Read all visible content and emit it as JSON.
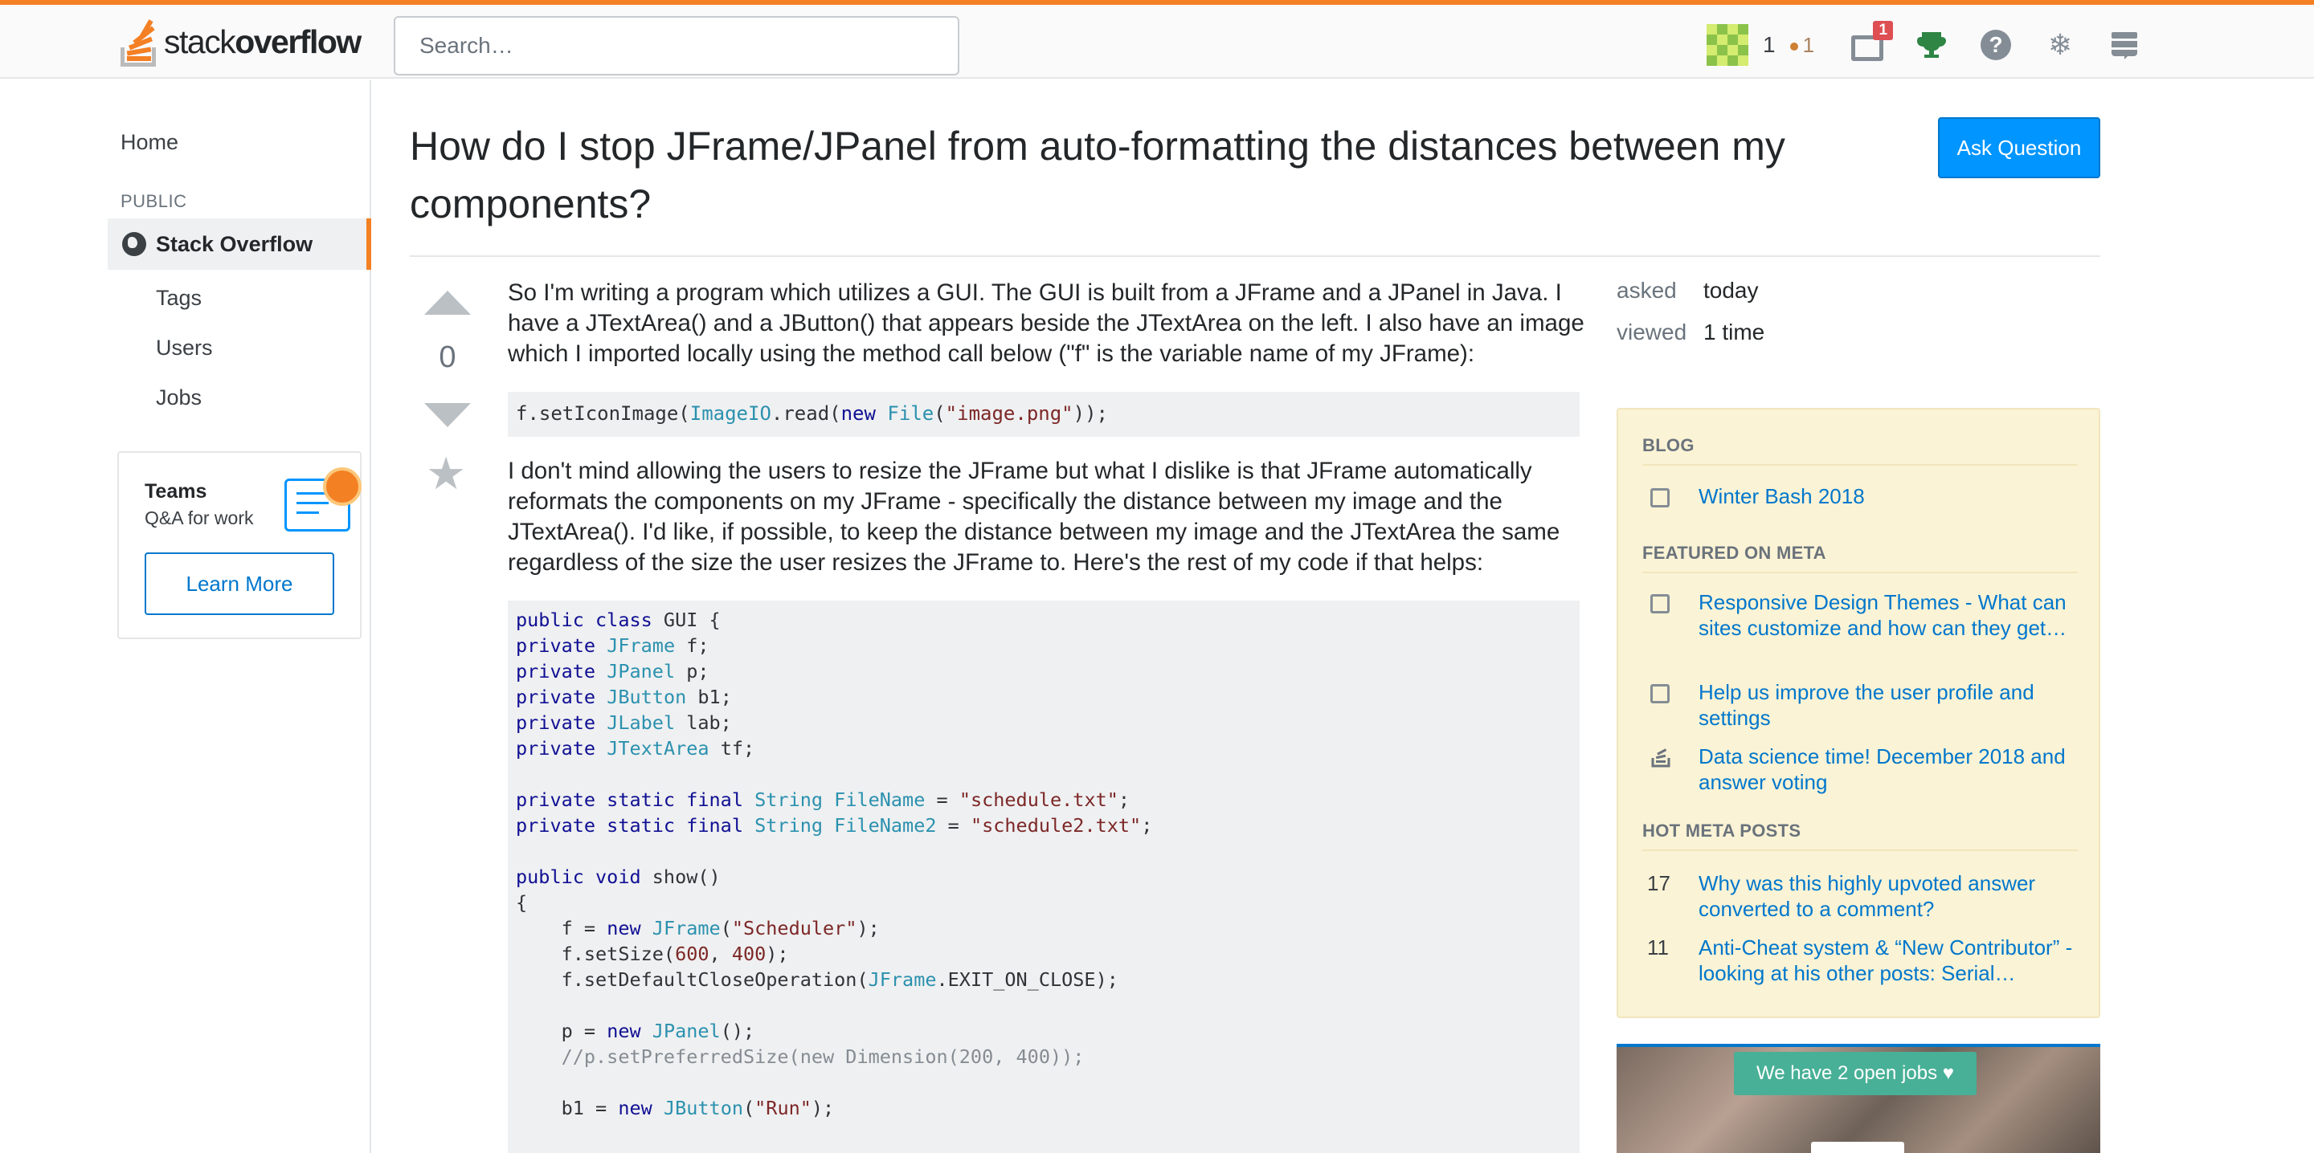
{
  "header": {
    "logo_light": "stack",
    "logo_bold": "overflow",
    "search_placeholder": "Search…",
    "reputation": "1",
    "bronze_badges": "1",
    "inbox_count": "1"
  },
  "nav": {
    "home": "Home",
    "public_heading": "PUBLIC",
    "stack_overflow": "Stack Overflow",
    "tags": "Tags",
    "users": "Users",
    "jobs": "Jobs"
  },
  "teams": {
    "title": "Teams",
    "subtitle": "Q&A for work",
    "button": "Learn More"
  },
  "question": {
    "title": "How do I stop JFrame/JPanel from auto-formatting the distances between my components?",
    "ask_button": "Ask Question",
    "votes": "0",
    "para1": "So I'm writing a program which utilizes a GUI. The GUI is built from a JFrame and a JPanel in Java. I have a JTextArea() and a JButton() that appears beside the JTextArea on the left. I also have an image which I imported locally using the method call below (\"f\" is the variable name of my JFrame):",
    "para2": "I don't mind allowing the users to resize the JFrame but what I dislike is that JFrame automatically reformats the components on my JFrame - specifically the distance between my image and the JTextArea(). I'd like, if possible, to keep the distance between my image and the JTextArea the same regardless of the size the user resizes the JFrame to. Here's the rest of my code if that helps:",
    "code_line": [
      {
        "t": "f.setIconImage(",
        "c": ""
      },
      {
        "t": "ImageIO",
        "c": "ty"
      },
      {
        "t": ".read(",
        "c": ""
      },
      {
        "t": "new",
        "c": "kw"
      },
      {
        "t": " ",
        "c": ""
      },
      {
        "t": "File",
        "c": "ty"
      },
      {
        "t": "(",
        "c": ""
      },
      {
        "t": "\"image.png\"",
        "c": "st"
      },
      {
        "t": "));",
        "c": ""
      }
    ],
    "code_block": [
      [
        {
          "t": "public class",
          "c": "kw"
        },
        {
          "t": " GUI {",
          "c": ""
        }
      ],
      [
        {
          "t": "private",
          "c": "kw"
        },
        {
          "t": " ",
          "c": ""
        },
        {
          "t": "JFrame",
          "c": "ty"
        },
        {
          "t": " f;",
          "c": ""
        }
      ],
      [
        {
          "t": "private",
          "c": "kw"
        },
        {
          "t": " ",
          "c": ""
        },
        {
          "t": "JPanel",
          "c": "ty"
        },
        {
          "t": " p;",
          "c": ""
        }
      ],
      [
        {
          "t": "private",
          "c": "kw"
        },
        {
          "t": " ",
          "c": ""
        },
        {
          "t": "JButton",
          "c": "ty"
        },
        {
          "t": " b1;",
          "c": ""
        }
      ],
      [
        {
          "t": "private",
          "c": "kw"
        },
        {
          "t": " ",
          "c": ""
        },
        {
          "t": "JLabel",
          "c": "ty"
        },
        {
          "t": " lab;",
          "c": ""
        }
      ],
      [
        {
          "t": "private",
          "c": "kw"
        },
        {
          "t": " ",
          "c": ""
        },
        {
          "t": "JTextArea",
          "c": "ty"
        },
        {
          "t": " tf;",
          "c": ""
        }
      ],
      [],
      [
        {
          "t": "private static final",
          "c": "kw"
        },
        {
          "t": " ",
          "c": ""
        },
        {
          "t": "String",
          "c": "ty"
        },
        {
          "t": " ",
          "c": ""
        },
        {
          "t": "FileName",
          "c": "ty"
        },
        {
          "t": " = ",
          "c": ""
        },
        {
          "t": "\"schedule.txt\"",
          "c": "st"
        },
        {
          "t": ";",
          "c": ""
        }
      ],
      [
        {
          "t": "private static final",
          "c": "kw"
        },
        {
          "t": " ",
          "c": ""
        },
        {
          "t": "String",
          "c": "ty"
        },
        {
          "t": " ",
          "c": ""
        },
        {
          "t": "FileName2",
          "c": "ty"
        },
        {
          "t": " = ",
          "c": ""
        },
        {
          "t": "\"schedule2.txt\"",
          "c": "st"
        },
        {
          "t": ";",
          "c": ""
        }
      ],
      [],
      [
        {
          "t": "public void",
          "c": "kw"
        },
        {
          "t": " show()",
          "c": ""
        }
      ],
      [
        {
          "t": "{",
          "c": ""
        }
      ],
      [
        {
          "t": "    f = ",
          "c": ""
        },
        {
          "t": "new",
          "c": "kw"
        },
        {
          "t": " ",
          "c": ""
        },
        {
          "t": "JFrame",
          "c": "ty"
        },
        {
          "t": "(",
          "c": ""
        },
        {
          "t": "\"Scheduler\"",
          "c": "st"
        },
        {
          "t": ");",
          "c": ""
        }
      ],
      [
        {
          "t": "    f.setSize(",
          "c": ""
        },
        {
          "t": "600",
          "c": "nu"
        },
        {
          "t": ", ",
          "c": ""
        },
        {
          "t": "400",
          "c": "nu"
        },
        {
          "t": ");",
          "c": ""
        }
      ],
      [
        {
          "t": "    f.setDefaultCloseOperation(",
          "c": ""
        },
        {
          "t": "JFrame",
          "c": "ty"
        },
        {
          "t": ".EXIT_ON_CLOSE);",
          "c": ""
        }
      ],
      [],
      [
        {
          "t": "    p = ",
          "c": ""
        },
        {
          "t": "new",
          "c": "kw"
        },
        {
          "t": " ",
          "c": ""
        },
        {
          "t": "JPanel",
          "c": "ty"
        },
        {
          "t": "();",
          "c": ""
        }
      ],
      [
        {
          "t": "    //p.setPreferredSize(new Dimension(200, 400));",
          "c": "cm"
        }
      ],
      [],
      [
        {
          "t": "    b1 = ",
          "c": ""
        },
        {
          "t": "new",
          "c": "kw"
        },
        {
          "t": " ",
          "c": ""
        },
        {
          "t": "JButton",
          "c": "ty"
        },
        {
          "t": "(",
          "c": ""
        },
        {
          "t": "\"Run\"",
          "c": "st"
        },
        {
          "t": ");",
          "c": ""
        }
      ]
    ]
  },
  "meta": {
    "asked_label": "asked",
    "asked_value": "today",
    "viewed_label": "viewed",
    "viewed_value": "1 time"
  },
  "sidebar": {
    "blog_heading": "BLOG",
    "blog_items": [
      "Winter Bash 2018"
    ],
    "featured_heading": "FEATURED ON META",
    "featured_items": [
      "Responsive Design Themes - What can sites customize and how can they get…",
      "Help us improve the user profile and settings",
      "Data science time! December 2018 and answer voting"
    ],
    "hot_heading": "HOT META POSTS",
    "hot_items": [
      {
        "count": "17",
        "title": "Why was this highly upvoted answer converted to a comment?"
      },
      {
        "count": "11",
        "title": "Anti-Cheat system & “New Contributor” - looking at his other posts: Serial…"
      }
    ],
    "jobs_text": "We have 2 open jobs ♥"
  },
  "colors": {
    "accent": "#f48024",
    "link": "#0077cc",
    "primary_button": "#0095ff",
    "sidebar_bg": "#fbf3d5"
  }
}
